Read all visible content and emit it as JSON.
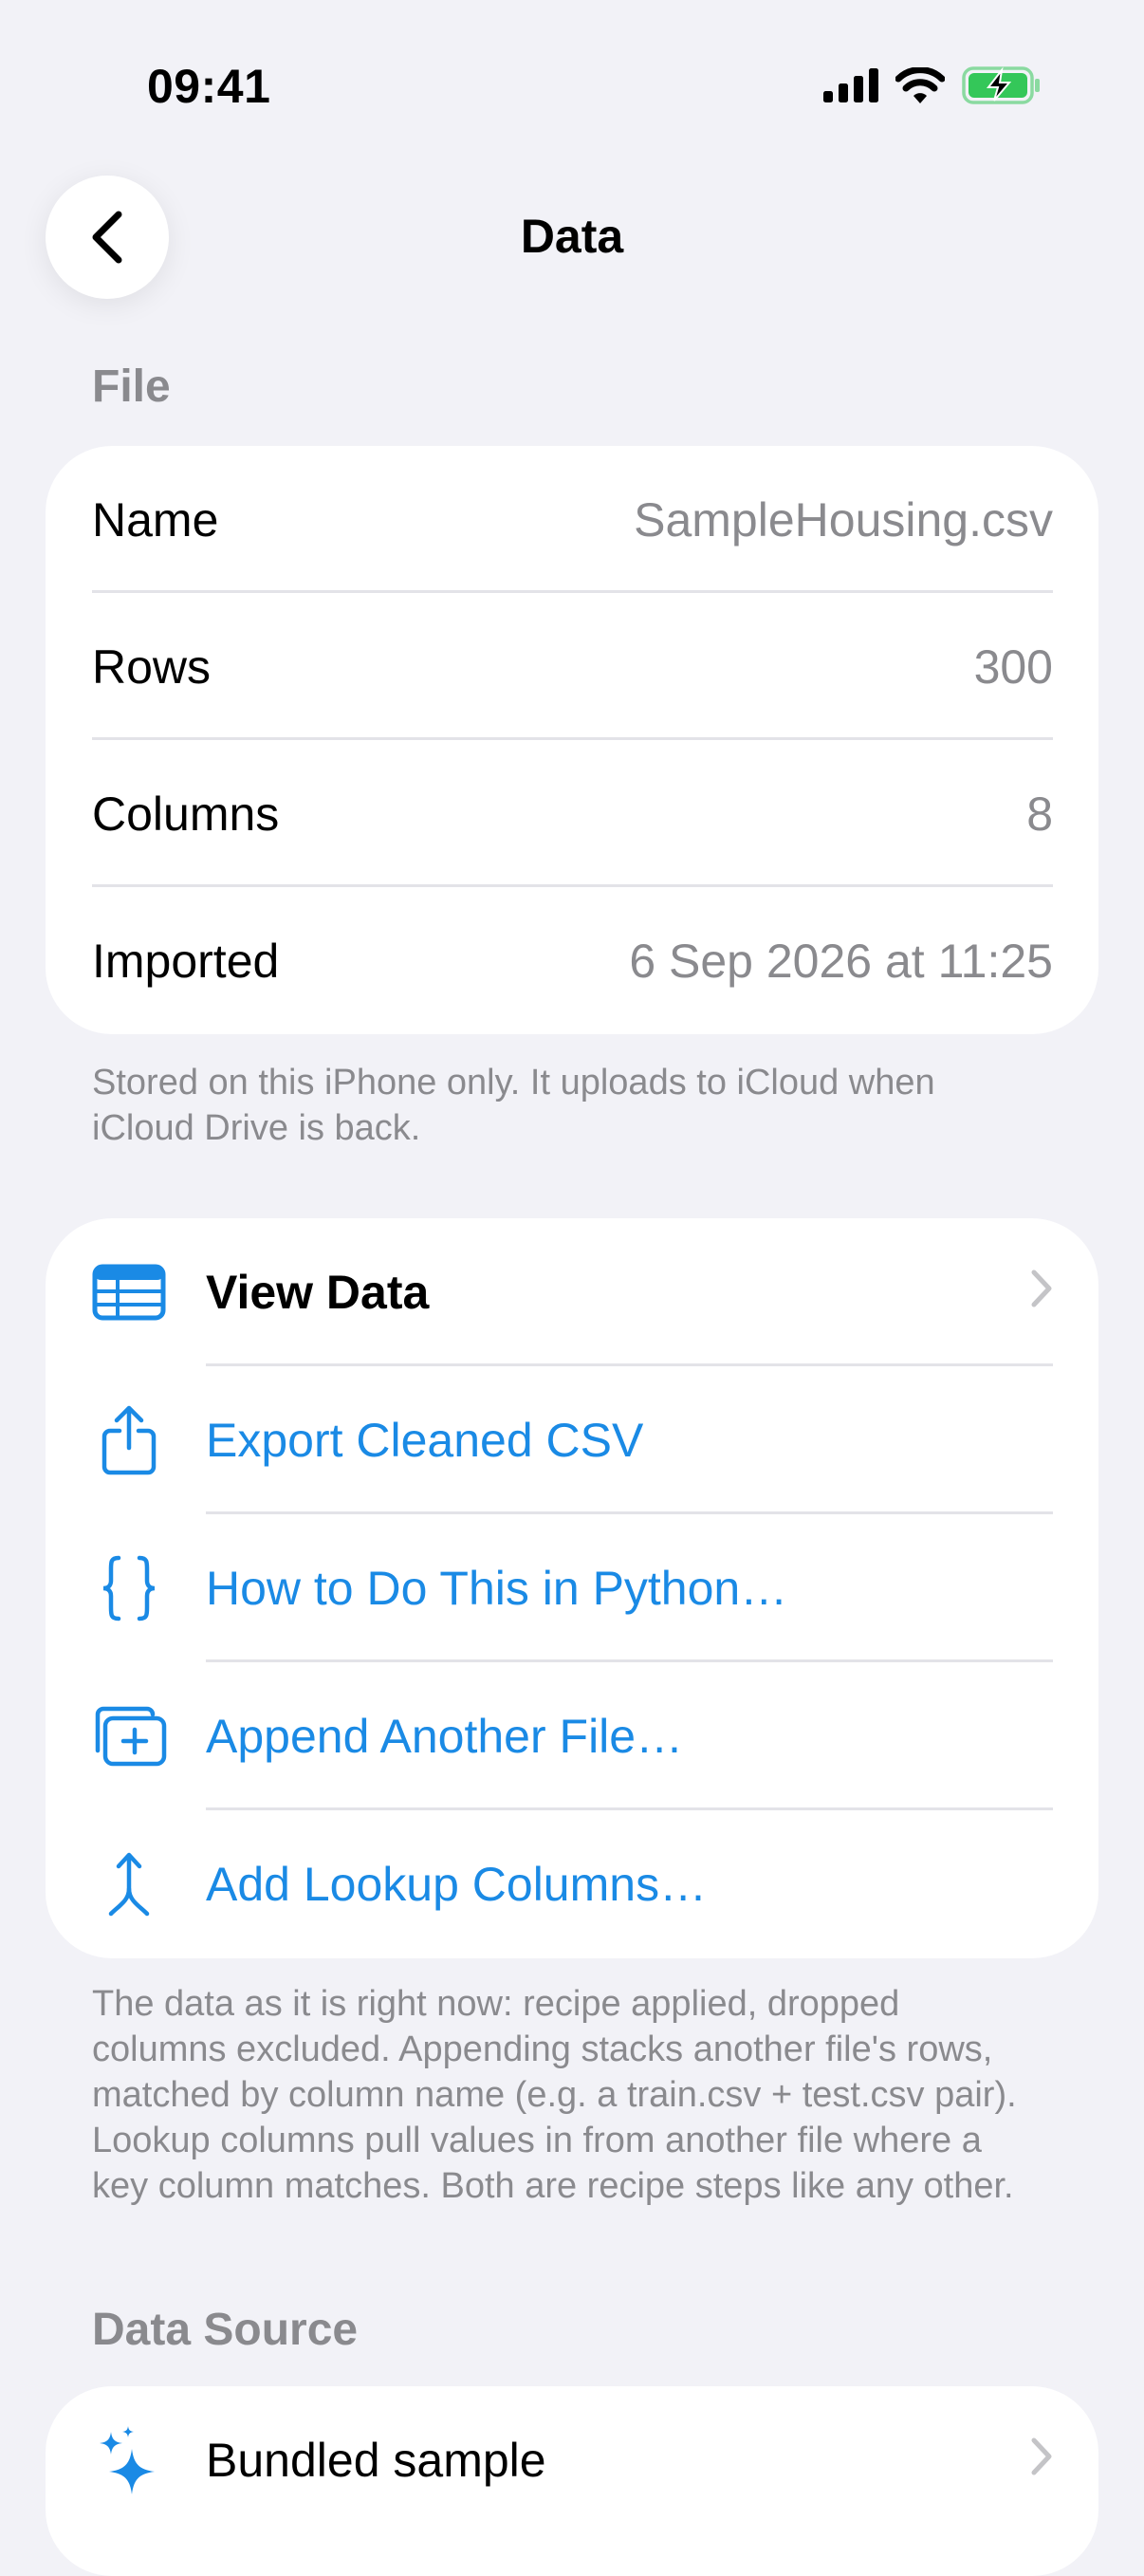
{
  "status_bar": {
    "time": "09:41"
  },
  "nav": {
    "title": "Data",
    "back_icon": "chevron-left-icon"
  },
  "file_section": {
    "header": "File",
    "rows": [
      {
        "label": "Name",
        "value": "SampleHousing.csv"
      },
      {
        "label": "Rows",
        "value": "300"
      },
      {
        "label": "Columns",
        "value": "8"
      },
      {
        "label": "Imported",
        "value": "6 Sep 2026 at 11:25"
      }
    ],
    "footnote": "Stored on this iPhone only. It uploads to iCloud when iCloud Drive is back."
  },
  "actions_section": {
    "items": [
      {
        "label": "View Data",
        "icon": "table-icon"
      },
      {
        "label": "Export Cleaned CSV",
        "icon": "share-icon"
      },
      {
        "label": "How to Do This in Python…",
        "icon": "curly-braces-icon"
      },
      {
        "label": "Append Another File…",
        "icon": "add-stack-icon"
      },
      {
        "label": "Add Lookup Columns…",
        "icon": "merge-arrow-icon"
      }
    ],
    "footnote": "The data as it is right now: recipe applied, dropped columns excluded. Appending stacks another file's rows, matched by column name (e.g. a train.csv + test.csv pair). Lookup columns pull values in from another file where a key column matches. Both are recipe steps like any other."
  },
  "data_source_section": {
    "header": "Data Source",
    "items": [
      {
        "label": "Bundled sample",
        "icon": "sparkles-icon"
      }
    ]
  },
  "colors": {
    "accent": "#1A8AE5",
    "background": "#F2F2F7",
    "secondary_text": "#8A8A8E",
    "battery_green": "#34C759"
  }
}
